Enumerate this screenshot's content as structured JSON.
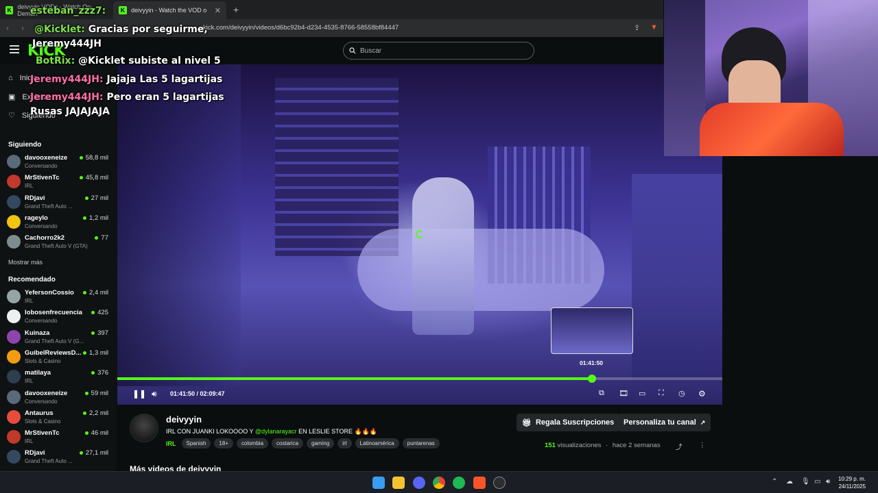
{
  "browser": {
    "tabs": [
      {
        "label": "deivyyin VODs - Watch On-Deman"
      },
      {
        "label": "deivyyin - Watch the VOD on"
      }
    ],
    "url": "kick.com/deivyyin/videos/d6bc92b4-d234-4535-8766-58558bf84447"
  },
  "header": {
    "logo": "KICK",
    "search_placeholder": "Buscar"
  },
  "sidebar": {
    "nav": [
      {
        "label": "Inicio",
        "icon": "home-icon"
      },
      {
        "label": "Explorar",
        "icon": "explore-icon"
      },
      {
        "label": "Siguiendo",
        "icon": "heart-icon"
      }
    ],
    "following_title": "Siguiendo",
    "following": [
      {
        "name": "davooxeneize",
        "category": "Conversando",
        "viewers": "58,8 mil",
        "color": "#5a6a7a"
      },
      {
        "name": "MrStivenTc",
        "category": "IRL",
        "viewers": "45,8 mil",
        "color": "#c0392b"
      },
      {
        "name": "RDjavi",
        "category": "Grand Theft Auto ...",
        "viewers": "27 mil",
        "color": "#34495e"
      },
      {
        "name": "rageylo",
        "category": "Conversando",
        "viewers": "1,2 mil",
        "color": "#f1c40f"
      },
      {
        "name": "Cachorro2k2",
        "category": "Grand Theft Auto V (GTA)",
        "viewers": "77",
        "color": "#7f8c8d"
      }
    ],
    "show_more": "Mostrar más",
    "recommended_title": "Recomendado",
    "recommended": [
      {
        "name": "YefersonCossio",
        "category": "IRL",
        "viewers": "2,4 mil",
        "color": "#95a5a6"
      },
      {
        "name": "lobosenfrecuencia",
        "category": "Conversando",
        "viewers": "425",
        "color": "#ecf0f1"
      },
      {
        "name": "Kuinaza",
        "category": "Grand Theft Auto V (G...",
        "viewers": "397",
        "color": "#8e44ad"
      },
      {
        "name": "GuibelReviewsD...",
        "category": "Slots & Casino",
        "viewers": "1,3 mil",
        "color": "#f39c12"
      },
      {
        "name": "matilaya",
        "category": "IRL",
        "viewers": "376",
        "color": "#2c3e50"
      },
      {
        "name": "davooxeneize",
        "category": "Conversando",
        "viewers": "59 mil",
        "color": "#5a6a7a"
      },
      {
        "name": "Antaurus",
        "category": "Slots & Casino",
        "viewers": "2,2 mil",
        "color": "#e74c3c"
      },
      {
        "name": "MrStivenTc",
        "category": "IRL",
        "viewers": "46 mil",
        "color": "#c0392b"
      },
      {
        "name": "RDjavi",
        "category": "Grand Theft Auto ...",
        "viewers": "27,1 mil",
        "color": "#34495e"
      }
    ]
  },
  "chat_overlay": [
    {
      "user": "esteban_zzz7:",
      "text": ""
    },
    {
      "user": "@Kicklet:",
      "text": "Gracias por seguirme,"
    },
    {
      "user": "",
      "text": "Jeremy444JH"
    },
    {
      "user": "BotRix:",
      "text": "@Kicklet subiste al nivel 5"
    },
    {
      "user": "Jeremy444JH:",
      "text": "Jajaja Las 5 lagartijas"
    },
    {
      "user": "Jeremy444JH:",
      "text": "Pero eran 5 lagartijas"
    },
    {
      "user": "",
      "text": "Rusas JAJAJAJA"
    }
  ],
  "player": {
    "current_time": "01:41:50",
    "duration": "02:09:47",
    "time_display": "01:41:50 / 02:09:47",
    "preview_time": "01:41:50",
    "progress": 0.785
  },
  "stream": {
    "channel": "deivyyin",
    "title_prefix": "IRL CON JUANKI LOKOOOO Y",
    "title_mention": "@dylanarayacr",
    "title_suffix": "EN LESLIE STORE 🔥🔥🔥",
    "category": "IRL",
    "tags": [
      "Spanish",
      "18+",
      "colombia",
      "costarica",
      "gaming",
      "irl",
      "Latinoamérica",
      "puntarenas"
    ],
    "gift_button": "Regala Suscripciones",
    "customize_button": "Personaliza tu canal",
    "views_count": "151",
    "views_label": "visualizaciones",
    "age": "hace 2 semanas",
    "more_videos": "Más videos de deivyyin"
  },
  "taskbar": {
    "time": "10:29 p. m.",
    "date": "24/11/2025"
  },
  "colors": {
    "accent": "#53fc18",
    "bg": "#0b0e0f"
  }
}
